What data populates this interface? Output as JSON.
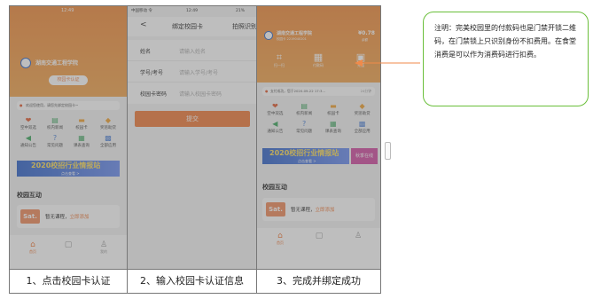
{
  "colors": {
    "accent": "#f07a3a",
    "orange_bg": "#f2a04a",
    "border": "#777777",
    "callout_border": "#6abf3a",
    "arrow": "#f08a4a"
  },
  "panel1": {
    "statusbar": "12:49",
    "school": "湖南交通工程学院",
    "button": "校园卡认证",
    "notice": "欢迎您使用，请您先绑定校园卡~",
    "grid": [
      {
        "label": "空中双选",
        "icon": "handshake-icon",
        "color": "red"
      },
      {
        "label": "校内新闻",
        "icon": "book-icon",
        "color": "grn"
      },
      {
        "label": "校园卡",
        "icon": "card-icon",
        "color": "org"
      },
      {
        "label": "奖惩助贷",
        "icon": "gift-icon",
        "color": "org"
      },
      {
        "label": "通知公告",
        "icon": "speaker-icon",
        "color": "grn"
      },
      {
        "label": "常见问题",
        "icon": "question-icon",
        "color": "blu"
      },
      {
        "label": "课表查询",
        "icon": "calendar-icon",
        "color": "grn"
      },
      {
        "label": "全部应用",
        "icon": "apps-icon",
        "color": "blu"
      }
    ],
    "banner": "2020校招行业情报站",
    "banner_sub": "点击查看 >",
    "section": "校园互动",
    "sat": "Sat.",
    "no_course": "暂无课程，",
    "add": "立即添加",
    "nav": [
      "首页",
      "",
      "我的"
    ]
  },
  "panel2": {
    "statusbar": "中国移动 令",
    "time": "12:49",
    "battery": "21%",
    "back": "<",
    "title": "绑定校园卡",
    "right": "拍照识别",
    "fields": [
      {
        "label": "姓名",
        "placeholder": "请输入姓名"
      },
      {
        "label": "学号/考号",
        "placeholder": "请输入学号/考号"
      },
      {
        "label": "校园卡密码",
        "placeholder": "请输入校园卡密码"
      }
    ],
    "button": "提交"
  },
  "panel3": {
    "school": "湖南交通工程学院",
    "sub": "校园卡 2219040201",
    "balance": "¥0.78",
    "balance_label": "余额",
    "icons": [
      {
        "label": "扫一扫",
        "icon": "scan-icon"
      },
      {
        "label": "付款码",
        "icon": "qrcode-icon"
      },
      {
        "label": "充值",
        "icon": "wallet-icon"
      }
    ],
    "notice": "支付成功，您于2020-09-22 17:3…",
    "notice_time": "24分钟",
    "grid": [
      {
        "label": "空中双选",
        "icon": "handshake-icon",
        "color": "red"
      },
      {
        "label": "校内新闻",
        "icon": "book-icon",
        "color": "grn"
      },
      {
        "label": "校园卡",
        "icon": "card-icon",
        "color": "org"
      },
      {
        "label": "奖惩助贷",
        "icon": "gift-icon",
        "color": "org"
      },
      {
        "label": "通知公告",
        "icon": "speaker-icon",
        "color": "grn"
      },
      {
        "label": "常见问题",
        "icon": "question-icon",
        "color": "blu"
      },
      {
        "label": "课表查询",
        "icon": "calendar-icon",
        "color": "grn"
      },
      {
        "label": "全部应用",
        "icon": "apps-icon",
        "color": "blu"
      }
    ],
    "banner": "2020校招行业情报站",
    "banner_sub": "点击查看 >",
    "banner_side": "秋季在线",
    "section": "校园互动",
    "sat": "Sat.",
    "no_course": "暂无课程，",
    "add": "立即添加",
    "nav": [
      "首页",
      "",
      ""
    ]
  },
  "captions": [
    "1、点击校园卡认证",
    "2、输入校园卡认证信息",
    "3、完成并绑定成功"
  ],
  "callout": "注明：完美校园里的付款码也是门禁开锁二维码，在门禁锁上只识别身份不扣费用。在食堂消费是可以作为消费码进行扣费。"
}
